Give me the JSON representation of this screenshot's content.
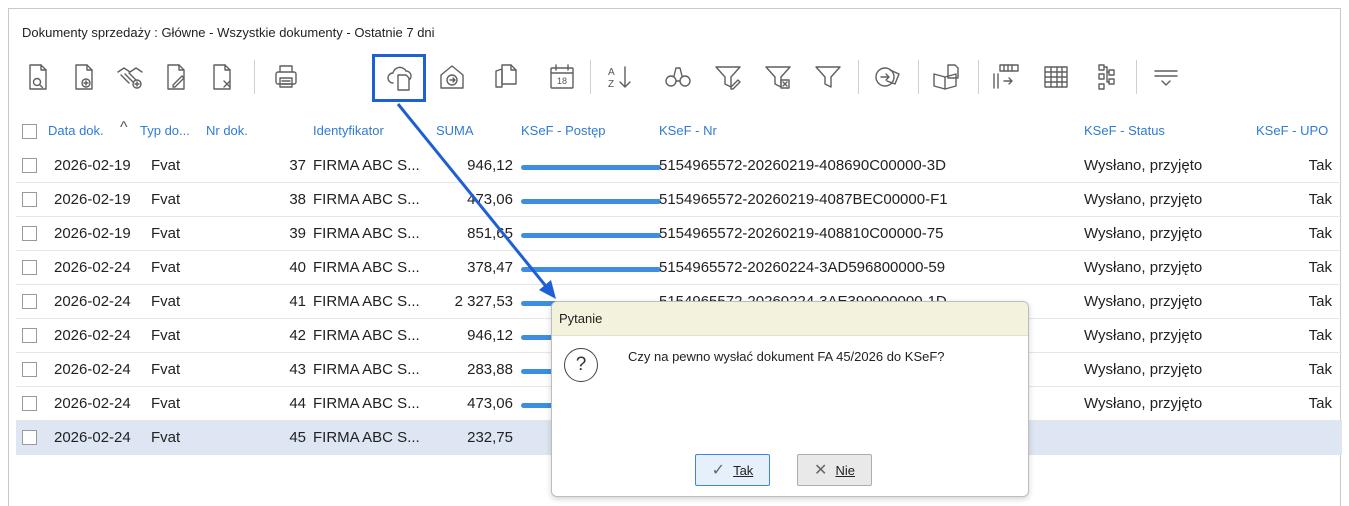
{
  "window": {
    "title": "Dokumenty sprzedaży : Główne - Wszystkie dokumenty - Ostatnie 7 dni"
  },
  "toolbar": {
    "buttons": [
      {
        "icon": "document-preview-icon"
      },
      {
        "icon": "document-add-icon"
      },
      {
        "icon": "handshake-add-icon"
      },
      {
        "icon": "document-edit-icon"
      },
      {
        "icon": "document-delete-icon"
      },
      {
        "icon": "print-icon"
      },
      {
        "icon": "cloud-send-ksef-icon"
      },
      {
        "icon": "house-arrow-icon"
      },
      {
        "icon": "documents-copy-icon"
      },
      {
        "icon": "calendar-icon",
        "text": "18"
      },
      {
        "icon": "sort-az-icon",
        "text": "A Z"
      },
      {
        "icon": "binoculars-search-icon"
      },
      {
        "icon": "filter-edit-icon"
      },
      {
        "icon": "filter-clear-icon"
      },
      {
        "icon": "filter-icon"
      },
      {
        "icon": "export-arrow-icon"
      },
      {
        "icon": "book-document-icon"
      },
      {
        "icon": "columns-insert-icon"
      },
      {
        "icon": "grid-icon"
      },
      {
        "icon": "tree-structure-icon"
      },
      {
        "icon": "more-menu-icon"
      }
    ]
  },
  "table": {
    "columns": {
      "date": "Data dok.",
      "type": "Typ do...",
      "number": "Nr dok.",
      "identifier": "Identyfikator",
      "sum": "SUMA",
      "ksef_progress": "KSeF - Postęp",
      "ksef_nr": "KSeF - Nr",
      "ksef_status": "KSeF - Status",
      "ksef_upo": "KSeF - UPO"
    },
    "sort_indicator": "^",
    "rows": [
      {
        "date": "2026-02-19",
        "type": "Fvat",
        "number": "37",
        "identifier": "FIRMA ABC S...",
        "sum": "946,12",
        "progress": 1,
        "ksef_nr": "5154965572-20260219-408690C00000-3D",
        "status": "Wysłano, przyjęto",
        "upo": "Tak"
      },
      {
        "date": "2026-02-19",
        "type": "Fvat",
        "number": "38",
        "identifier": "FIRMA ABC S...",
        "sum": "473,06",
        "progress": 1,
        "ksef_nr": "5154965572-20260219-4087BEC00000-F1",
        "status": "Wysłano, przyjęto",
        "upo": "Tak"
      },
      {
        "date": "2026-02-19",
        "type": "Fvat",
        "number": "39",
        "identifier": "FIRMA ABC S...",
        "sum": "851,65",
        "progress": 1,
        "ksef_nr": "5154965572-20260219-408810C00000-75",
        "status": "Wysłano, przyjęto",
        "upo": "Tak"
      },
      {
        "date": "2026-02-24",
        "type": "Fvat",
        "number": "40",
        "identifier": "FIRMA ABC S...",
        "sum": "378,47",
        "progress": 1,
        "ksef_nr": "5154965572-20260224-3AD596800000-59",
        "status": "Wysłano, przyjęto",
        "upo": "Tak"
      },
      {
        "date": "2026-02-24",
        "type": "Fvat",
        "number": "41",
        "identifier": "FIRMA ABC S...",
        "sum": "2 327,53",
        "progress": 1,
        "ksef_nr": "5154965572-20260224-3AE390000000-1D",
        "status": "Wysłano, przyjęto",
        "upo": "Tak"
      },
      {
        "date": "2026-02-24",
        "type": "Fvat",
        "number": "42",
        "identifier": "FIRMA ABC S...",
        "sum": "946,12",
        "progress": 1,
        "ksef_nr": "",
        "status": "Wysłano, przyjęto",
        "upo": "Tak"
      },
      {
        "date": "2026-02-24",
        "type": "Fvat",
        "number": "43",
        "identifier": "FIRMA ABC S...",
        "sum": "283,88",
        "progress": 1,
        "ksef_nr": "",
        "status": "Wysłano, przyjęto",
        "upo": "Tak"
      },
      {
        "date": "2026-02-24",
        "type": "Fvat",
        "number": "44",
        "identifier": "FIRMA ABC S...",
        "sum": "473,06",
        "progress": 1,
        "ksef_nr": "",
        "status": "Wysłano, przyjęto",
        "upo": "Tak"
      },
      {
        "date": "2026-02-24",
        "type": "Fvat",
        "number": "45",
        "identifier": "FIRMA ABC S...",
        "sum": "232,75",
        "progress": 0,
        "ksef_nr": "",
        "status": "",
        "upo": ""
      }
    ]
  },
  "dialog": {
    "title": "Pytanie",
    "icon": "question-icon",
    "icon_glyph": "?",
    "message": "Czy na pewno wysłać dokument FA 45/2026 do KSeF?",
    "yes_label": "Tak",
    "no_label": "Nie",
    "yes_icon": "✓",
    "no_icon": "✕"
  },
  "colors": {
    "accent": "#2f7bd6",
    "highlight": "#1f5fd6",
    "progress": "#3d8ee0",
    "selected_row": "#dde6f2",
    "dialog_title": "#f3f3dd"
  }
}
